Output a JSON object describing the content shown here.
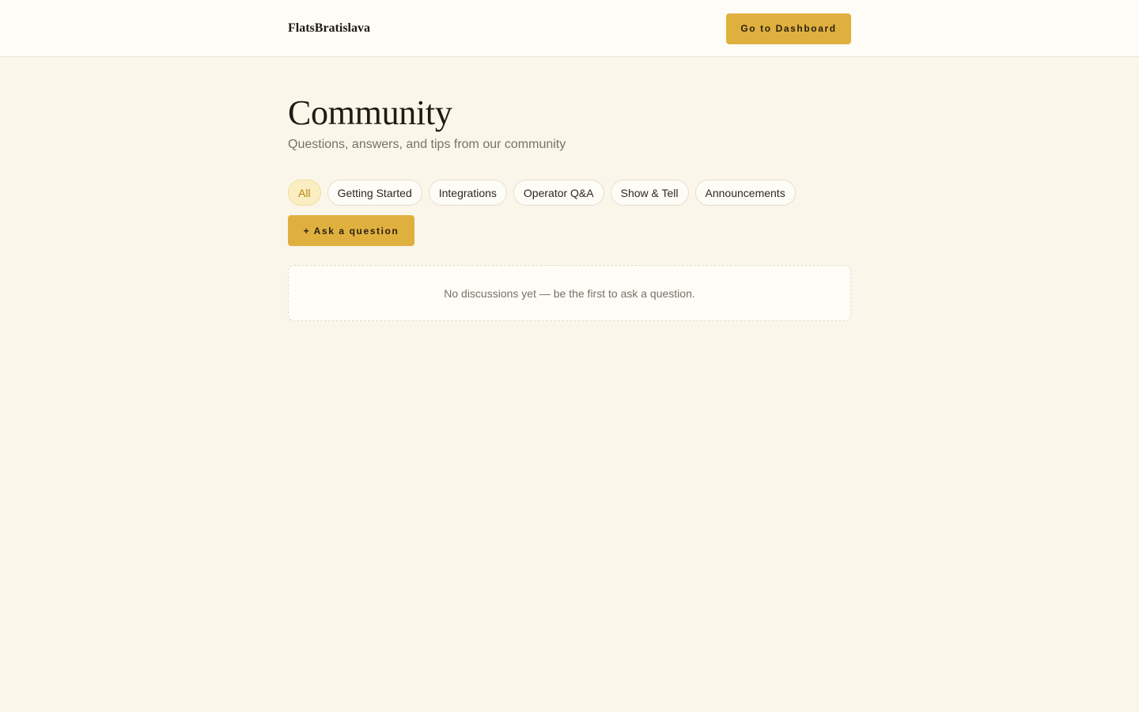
{
  "header": {
    "brand": "FlatsBratislava",
    "dashboard_label": "Go to Dashboard"
  },
  "page": {
    "title": "Community",
    "subtitle": "Questions, answers, and tips from our community"
  },
  "filters": [
    {
      "label": "All",
      "active": true
    },
    {
      "label": "Getting Started",
      "active": false
    },
    {
      "label": "Integrations",
      "active": false
    },
    {
      "label": "Operator Q&A",
      "active": false
    },
    {
      "label": "Show & Tell",
      "active": false
    },
    {
      "label": "Announcements",
      "active": false
    }
  ],
  "actions": {
    "ask_label": "+ Ask a question"
  },
  "empty_state": {
    "message": "No discussions yet — be the first to ask a question."
  },
  "colors": {
    "background": "#fbf6ea",
    "accent": "#e0b03f",
    "active_chip_bg": "#fbeec2",
    "active_chip_text": "#b4870d"
  }
}
